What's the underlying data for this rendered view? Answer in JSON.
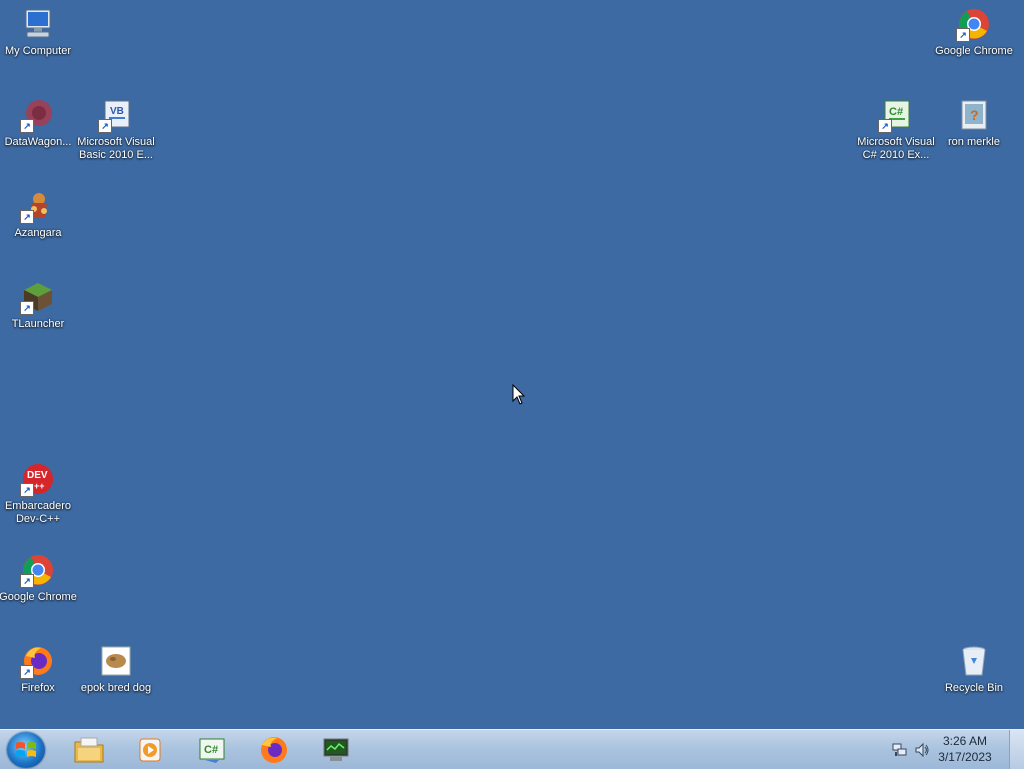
{
  "desktop": {
    "icons": [
      {
        "label": "My Computer"
      },
      {
        "label": "DataWagon..."
      },
      {
        "label": "Microsoft Visual Basic 2010 E..."
      },
      {
        "label": "Azangara"
      },
      {
        "label": "TLauncher"
      },
      {
        "label": "Embarcadero Dev-C++"
      },
      {
        "label": "Google Chrome"
      },
      {
        "label": "Firefox"
      },
      {
        "label": "epok bred dog"
      },
      {
        "label": "Google Chrome"
      },
      {
        "label": "Microsoft Visual C# 2010 Ex..."
      },
      {
        "label": "ron merkle"
      },
      {
        "label": "Recycle Bin"
      }
    ]
  },
  "taskbar": {
    "start": "start-button",
    "pinned": [
      "Windows Explorer",
      "Windows Media Player",
      "Microsoft Visual C# 2010 Express",
      "Firefox",
      "Network monitor"
    ],
    "clock": {
      "time": "3:26 AM",
      "date": "3/17/2023"
    },
    "accent": "#3d6aa2"
  }
}
